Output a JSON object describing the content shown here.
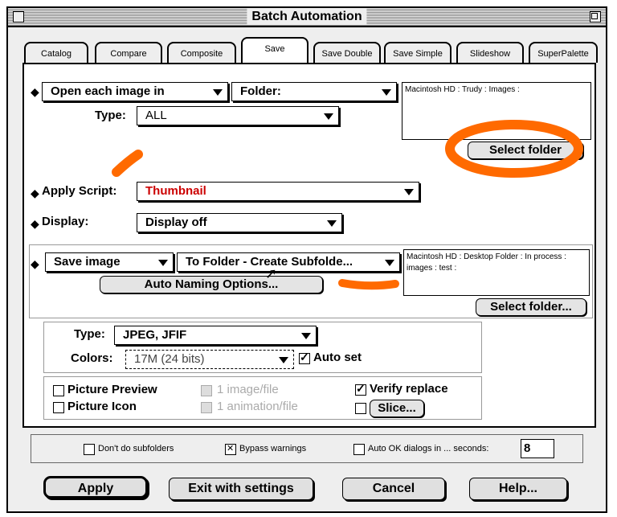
{
  "window": {
    "title": "Batch Automation"
  },
  "tabs": [
    "Catalog",
    "Compare",
    "Composite",
    "Save",
    "Save Double",
    "Save Simple",
    "Slideshow",
    "SuperPalette"
  ],
  "open": {
    "mode": "Open each image in",
    "source": "Folder:",
    "path": "Macintosh HD :  Trudy : Images :",
    "type_label": "Type:",
    "type_value": "ALL",
    "select_folder": "Select folder"
  },
  "script": {
    "label": "Apply Script:",
    "value": "Thumbnail",
    "value_color": "#cc0000"
  },
  "display": {
    "label": "Display:",
    "value": "Display off"
  },
  "save": {
    "mode": "Save image",
    "dest": "To Folder - Create Subfolde...",
    "path": "Macintosh HD : Desktop Folder : In process : images : test :",
    "auto_naming": "Auto Naming Options...",
    "select_folder": "Select folder..."
  },
  "format": {
    "type_label": "Type:",
    "type_value": "JPEG, JFIF",
    "colors_label": "Colors:",
    "colors_value": "17M (24 bits)",
    "auto_set": "Auto set"
  },
  "options": {
    "picture_preview": "Picture Preview",
    "picture_icon": "Picture Icon",
    "one_image": "1 image/file",
    "one_animation": "1 animation/file",
    "verify_replace": "Verify replace",
    "slice": "Slice..."
  },
  "bottom": {
    "no_subfolders": "Don't do subfolders",
    "bypass": "Bypass warnings",
    "auto_ok": "Auto OK dialogs in ... seconds:",
    "seconds": "8"
  },
  "buttons": {
    "apply": "Apply",
    "exit": "Exit with settings",
    "cancel": "Cancel",
    "help": "Help..."
  },
  "colors": {
    "annotation": "#ff6a00"
  }
}
